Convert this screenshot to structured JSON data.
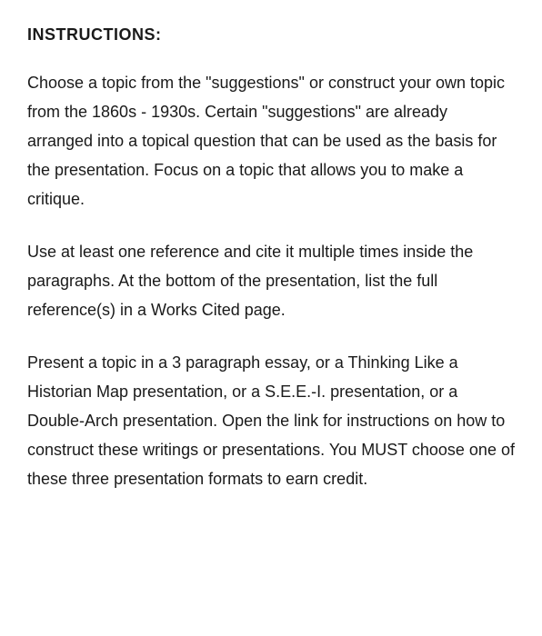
{
  "heading": "INSTRUCTIONS:",
  "paragraphs": [
    "Choose a topic from the \"suggestions\" or construct your own topic from the 1860s - 1930s.  Certain \"suggestions\" are already arranged into a topical question that can be used as the basis for the presentation.  Focus on a topic that allows you to make a critique.",
    "Use at least one reference and cite it multiple times inside the paragraphs.  At the bottom of the presentation, list the full reference(s) in a Works Cited page.",
    "Present a topic in a 3 paragraph essay, or a Thinking Like a Historian Map presentation, or a S.E.E.-I. presentation, or a Double-Arch presentation.  Open the link for instructions on how to construct these writings or  presentations.  You MUST choose one of these three presentation formats to earn credit."
  ]
}
